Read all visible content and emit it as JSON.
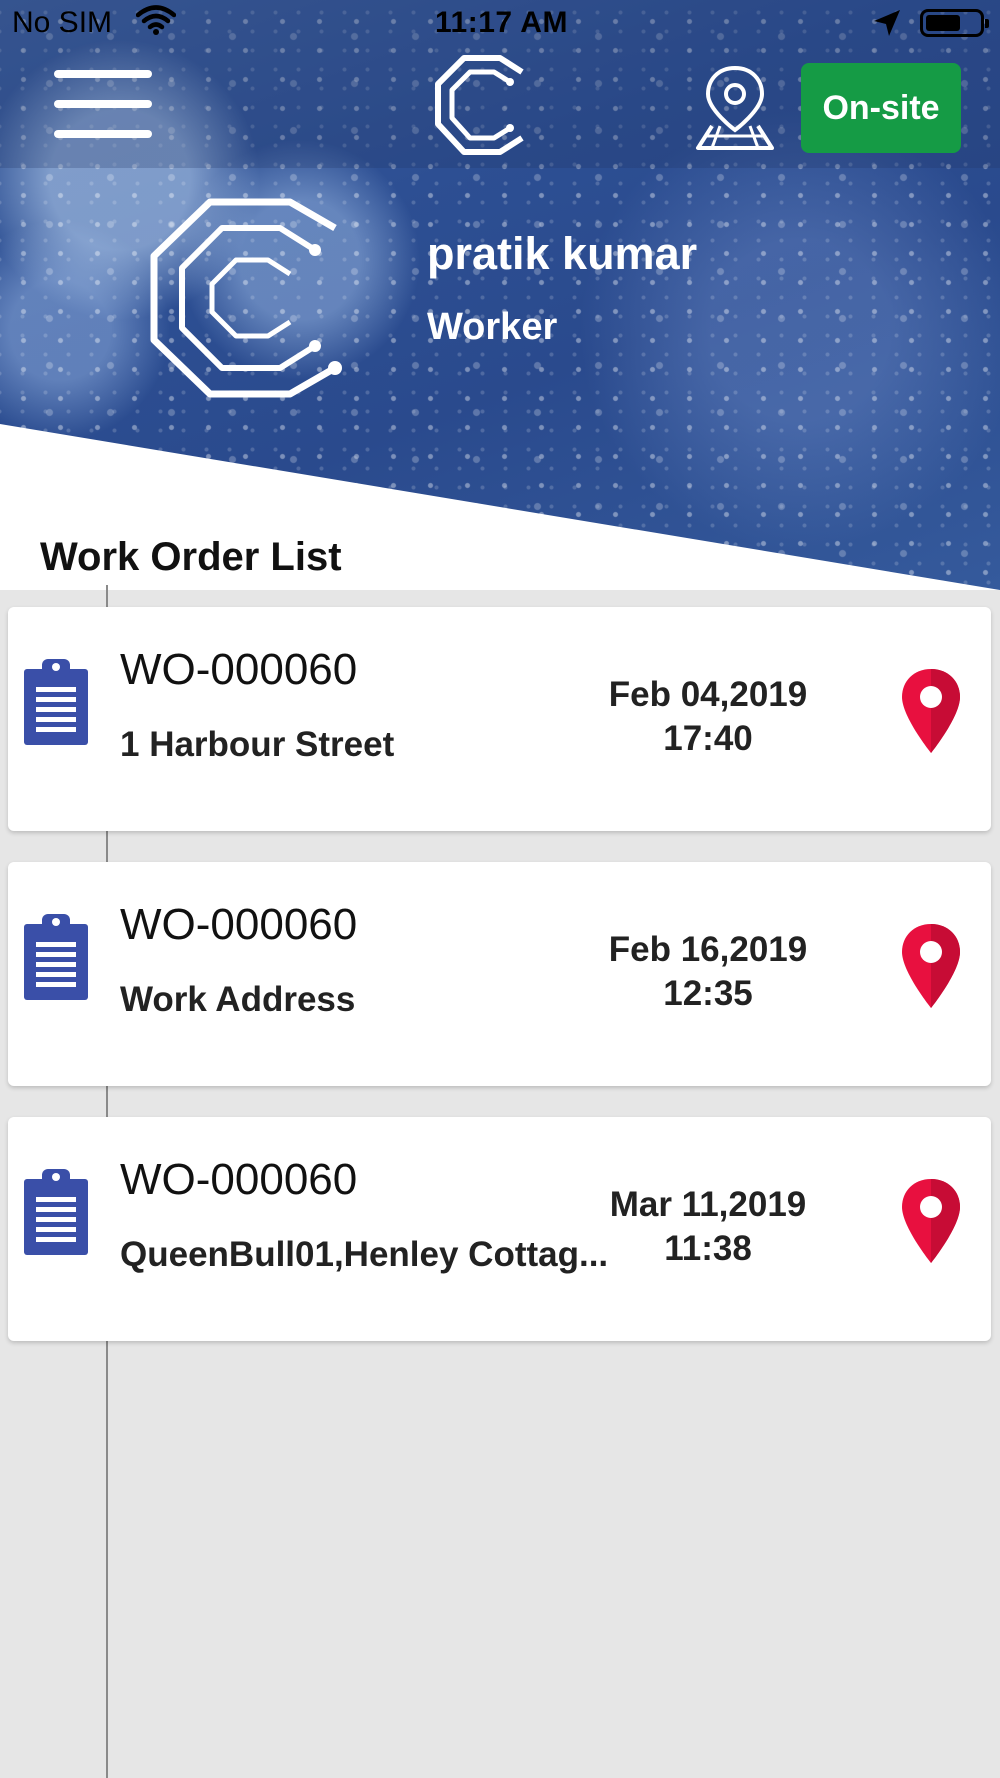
{
  "status_bar": {
    "carrier": "No SIM",
    "time": "11:17 AM",
    "icons": [
      "wifi-icon",
      "location-arrow-icon",
      "battery-icon"
    ]
  },
  "nav": {
    "menu_icon": "hamburger-menu-icon",
    "logo_icon": "app-logo-c",
    "map_icon": "map-pin-icon",
    "onsite_label": "On-site",
    "onsite_color": "#159b45"
  },
  "profile": {
    "name": "pratik kumar",
    "role": "Worker"
  },
  "list": {
    "title": "Work Order List",
    "items": [
      {
        "number": "WO-000060",
        "address": "1 Harbour Street",
        "date": "Feb 04,2019",
        "time": "17:40"
      },
      {
        "number": "WO-000060",
        "address": "Work Address",
        "date": "Feb 16,2019",
        "time": "12:35"
      },
      {
        "number": "WO-000060",
        "address": "QueenBull01,Henley Cottag...",
        "date": "Mar 11,2019",
        "time": "11:38"
      }
    ],
    "clipboard_color": "#3a4fa8",
    "pin_color": "#e8103f"
  }
}
